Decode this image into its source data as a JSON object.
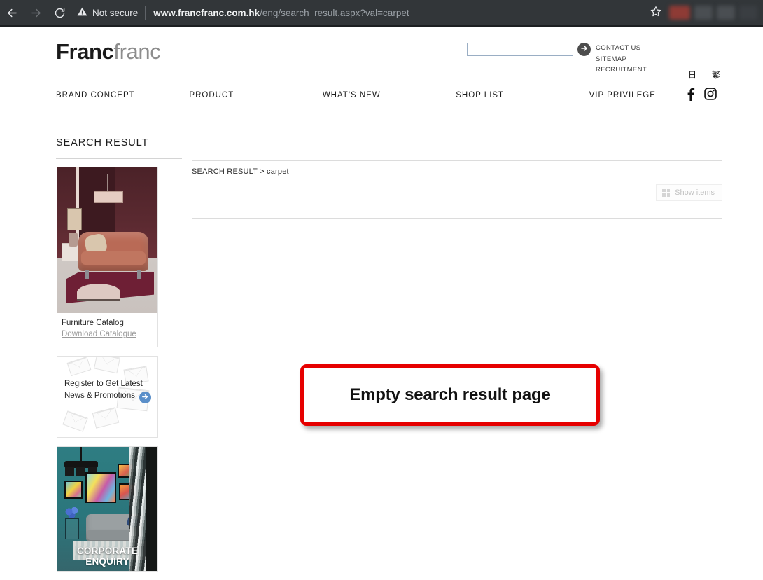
{
  "browser": {
    "back_icon": "back-arrow-icon",
    "forward_icon": "forward-arrow-icon",
    "reload_icon": "reload-icon",
    "security_label": "Not secure",
    "warning_icon": "warning-triangle-icon",
    "url_host": "www.francfranc.com.hk",
    "url_path": "/eng/search_result.aspx?val=carpet",
    "bookmark_icon": "star-icon"
  },
  "header": {
    "logo_bold": "Franc",
    "logo_light": "franc",
    "search": {
      "value": "",
      "placeholder": "",
      "submit_icon": "arrow-right-circle-icon"
    },
    "util_links": [
      "CONTACT US",
      "SITEMAP",
      "RECRUITMENT"
    ],
    "languages": [
      {
        "label": "日",
        "name": "language-japanese"
      },
      {
        "label": "繁",
        "name": "language-traditional-chinese"
      }
    ],
    "social": [
      {
        "name": "facebook-icon"
      },
      {
        "name": "instagram-icon"
      }
    ]
  },
  "nav": {
    "items": [
      "BRAND CONCEPT",
      "PRODUCT",
      "WHAT'S NEW",
      "SHOP LIST",
      "VIP PRIVILEGE"
    ]
  },
  "sidebar": {
    "section_title": "SEARCH RESULT",
    "banners": [
      {
        "name": "furniture-catalog-banner",
        "title": "Furniture Catalog",
        "link": "Download Catalogue"
      },
      {
        "name": "newsletter-signup-banner",
        "text": "Register to Get Latest News & Promotions",
        "go_icon": "arrow-right-circle-icon"
      },
      {
        "name": "corporate-enquiry-banner",
        "label": "CORPORATE ENQUIRY"
      }
    ]
  },
  "content": {
    "breadcrumb": "SEARCH RESULT > carpet",
    "show_items_label": "Show items",
    "show_items_icon": "grid-icon",
    "results": []
  },
  "annotation": {
    "text": "Empty search result page",
    "border_color": "#e60000"
  }
}
